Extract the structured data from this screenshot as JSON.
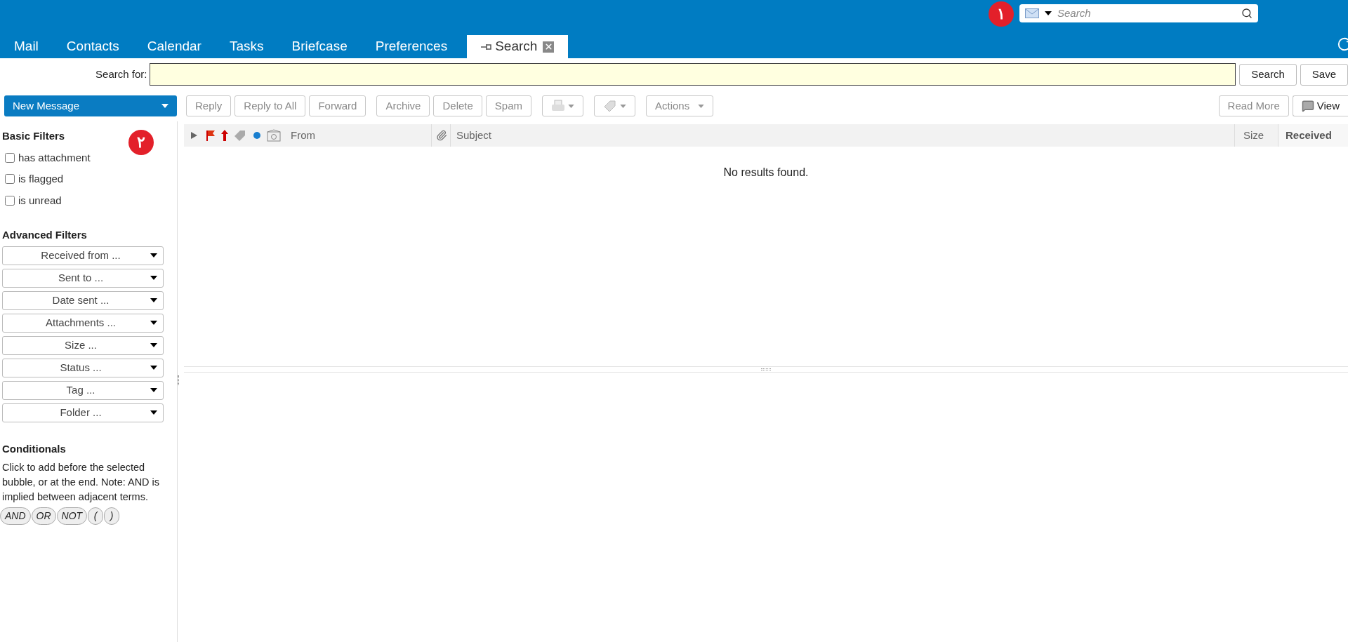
{
  "header": {
    "marker": "١",
    "search": {
      "placeholder": "Search"
    }
  },
  "tabs": [
    {
      "label": "Mail",
      "selected": false,
      "kind": "plain"
    },
    {
      "label": "Contacts",
      "selected": false,
      "kind": "plain"
    },
    {
      "label": "Calendar",
      "selected": false,
      "kind": "plain"
    },
    {
      "label": "Tasks",
      "selected": false,
      "kind": "plain"
    },
    {
      "label": "Briefcase",
      "selected": false,
      "kind": "plain"
    },
    {
      "label": "Preferences",
      "selected": false,
      "kind": "plain"
    },
    {
      "label": "Search",
      "selected": true,
      "kind": "pinned"
    }
  ],
  "search_bar": {
    "label": "Search for:",
    "buttons": [
      "Search",
      "Save"
    ]
  },
  "toolbar": {
    "new_message": "New Message",
    "buttons": [
      {
        "kind": "text",
        "label": "Reply",
        "disabled": true
      },
      {
        "kind": "text",
        "label": "Reply to All",
        "disabled": true
      },
      {
        "kind": "text",
        "label": "Forward",
        "disabled": true
      },
      {
        "kind": "text",
        "label": "Archive",
        "disabled": true
      },
      {
        "kind": "text",
        "label": "Delete",
        "disabled": true
      },
      {
        "kind": "text",
        "label": "Spam",
        "disabled": true
      },
      {
        "kind": "print",
        "disabled": true
      },
      {
        "kind": "tag",
        "disabled": true
      },
      {
        "kind": "menu",
        "label": "Actions",
        "disabled": true
      }
    ],
    "right_buttons": [
      {
        "kind": "text",
        "label": "Read More",
        "disabled": true
      },
      {
        "kind": "view",
        "label": "View",
        "disabled": false
      }
    ]
  },
  "sidebar": {
    "basic_filters": {
      "title": "Basic Filters",
      "marker": "٢",
      "items": [
        {
          "label": "has attachment",
          "checked": false
        },
        {
          "label": "is flagged",
          "checked": false
        },
        {
          "label": "is unread",
          "checked": false
        }
      ]
    },
    "advanced_filters": {
      "title": "Advanced Filters",
      "items": [
        "Received from ...",
        "Sent to ...",
        "Date sent ...",
        "Attachments ...",
        "Size ...",
        "Status ...",
        "Tag ...",
        "Folder ..."
      ]
    },
    "conditionals": {
      "title": "Conditionals",
      "text": "Click to add before the selected bubble, or at the end. Note: AND is implied between adjacent terms.",
      "bubbles": [
        "AND",
        "OR",
        "NOT",
        "(",
        ")"
      ]
    }
  },
  "message_list": {
    "columns": [
      {
        "label": "From",
        "sorted": false
      },
      {
        "label": "Subject",
        "sorted": false
      },
      {
        "label": "Size",
        "sorted": false
      },
      {
        "label": "Received",
        "sorted": true
      }
    ],
    "empty_text": "No results found."
  }
}
